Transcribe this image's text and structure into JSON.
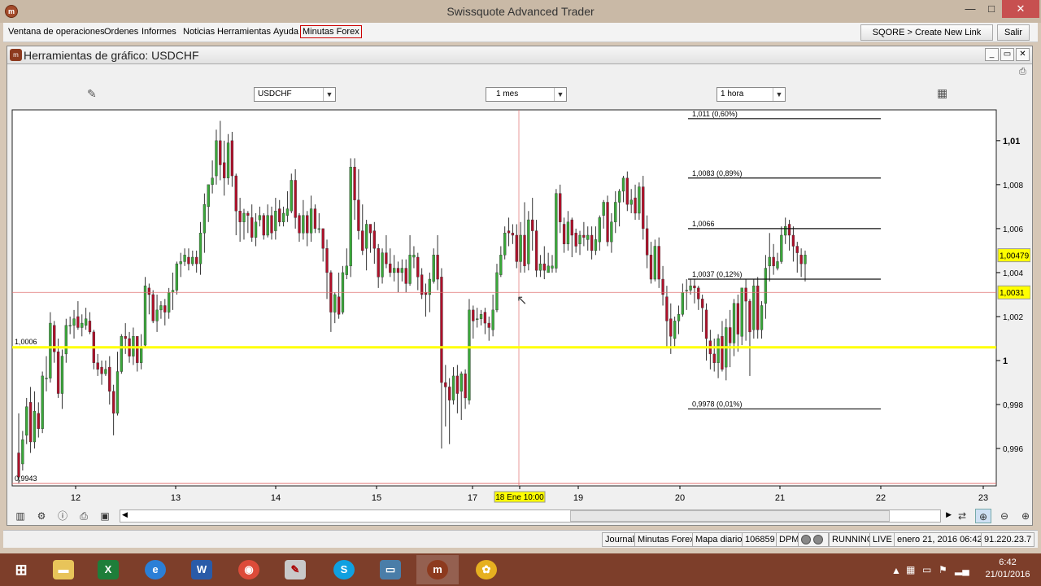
{
  "window": {
    "title": "Swissquote Advanced Trader",
    "min": "—",
    "max": "□",
    "close": "✕"
  },
  "menu": {
    "items": [
      "Ventana de operaciones",
      "Ordenes",
      "Informes",
      "Noticias",
      "Herramientas",
      "Ayuda",
      "Minutas Forex"
    ],
    "create_link": "SQORE > Create New Link",
    "exit": "Salir"
  },
  "chart_window": {
    "title": "Herramientas de gráfico: USDCHF",
    "symbol": "USDCHF",
    "period": "1 mes",
    "interval": "1 hora"
  },
  "status": {
    "items": [
      "Journal",
      "Minutas Forex",
      "Mapa diario",
      "106859",
      "DPM",
      "RUNNING",
      "LIVE",
      "enero 21, 2016 06:42",
      "91.220.23.7"
    ]
  },
  "taskbar": {
    "time": "6:42",
    "date": "21/01/2016"
  },
  "colors": {
    "up": "#3aa83a",
    "down": "#b0102a",
    "hline": "#ffff00",
    "crosshair": "#e07070"
  },
  "chart_data": {
    "type": "candlestick",
    "symbol": "USDCHF",
    "ylim": [
      0.9943,
      1.0114
    ],
    "y_ticks": [
      "1,01",
      "1,008",
      "1,006",
      "1,004",
      "1,002",
      "1",
      "0,998",
      "0,996"
    ],
    "x_ticks": [
      "12",
      "13",
      "14",
      "15",
      "17",
      "18 Ene 10:00",
      "19",
      "20",
      "21",
      "22",
      "23"
    ],
    "x_highlight": "18 Ene 10:00",
    "price_labels": {
      "last": "1,00479",
      "crosshair": "1,0031"
    },
    "left_labels": {
      "hline": "1,0006",
      "low": "0,9943"
    },
    "fib_levels": [
      {
        "price": 1.011,
        "label": "1,011 (0,60%)"
      },
      {
        "price": 1.0083,
        "label": "1,0083 (0,89%)"
      },
      {
        "price": 1.006,
        "label": "1,0066"
      },
      {
        "price": 1.0037,
        "label": "1,0037 (0,12%)"
      },
      {
        "price": 0.9978,
        "label": "0,9978 (0,01%)"
      }
    ],
    "horizontal_line": 1.0006,
    "candles": [
      [
        0.9958,
        0.9947,
        0.9976,
        0.9944
      ],
      [
        0.9953,
        0.9964,
        0.9968,
        0.995
      ],
      [
        0.9966,
        0.9979,
        0.9983,
        0.9962
      ],
      [
        0.9981,
        0.9963,
        0.9988,
        0.9958
      ],
      [
        0.9963,
        0.9977,
        0.9986,
        0.996
      ],
      [
        0.9976,
        0.9969,
        0.9981,
        0.9965
      ],
      [
        0.9969,
        0.9993,
        0.9995,
        0.9967
      ],
      [
        0.9992,
        0.9992,
        1.0002,
        0.9986
      ],
      [
        0.9992,
        1.0017,
        1.0022,
        0.999
      ],
      [
        1.0016,
        1.0004,
        1.0018,
        0.9999
      ],
      [
        1.0004,
        0.9985,
        1.001,
        0.9983
      ],
      [
        0.9985,
        1.0002,
        1.0005,
        0.9978
      ],
      [
        1.0003,
        1.0016,
        1.0019,
        0.9999
      ],
      [
        1.0016,
        1.0016,
        1.002,
        1.0012
      ],
      [
        1.0016,
        1.0019,
        1.0023,
        1.001
      ],
      [
        1.002,
        1.0015,
        1.0027,
        1.0014
      ],
      [
        1.0015,
        1.0017,
        1.0021,
        1.0011
      ],
      [
        1.0016,
        1.0019,
        1.0024,
        1.0014
      ],
      [
        1.0018,
        1.0013,
        1.0022,
        1.0012
      ],
      [
        1.0013,
        0.9999,
        1.0014,
        0.9996
      ],
      [
        0.9999,
        0.9996,
        1.0003,
        0.9993
      ],
      [
        0.9997,
        0.9994,
        1.0,
        0.9989
      ],
      [
        0.9994,
        0.9996,
        1.0,
        0.9993
      ],
      [
        0.9997,
        0.9986,
        1.0002,
        0.998
      ],
      [
        0.9986,
        0.9976,
        0.9989,
        0.9966
      ],
      [
        0.9976,
        0.9995,
        1.0004,
        0.9975
      ],
      [
        0.9995,
        1.0011,
        1.0012,
        0.9994
      ],
      [
        1.0011,
        1.001,
        1.0017,
        1.0003
      ],
      [
        1.001,
        1.0002,
        1.0013,
        0.9999
      ],
      [
        1.0002,
        1.0011,
        1.0015,
        0.9998
      ],
      [
        1.0011,
        0.9999,
        1.0011,
        0.9995
      ],
      [
        0.9999,
        1.0006,
        1.0012,
        0.9996
      ],
      [
        1.0007,
        1.0034,
        1.0038,
        1.0006
      ],
      [
        1.0033,
        1.003,
        1.0035,
        1.0021
      ],
      [
        1.003,
        1.0018,
        1.0032,
        1.0017
      ],
      [
        1.0018,
        1.0023,
        1.003,
        1.0013
      ],
      [
        1.0023,
        1.0025,
        1.0027,
        1.0019
      ],
      [
        1.0025,
        1.0022,
        1.0028,
        1.0016
      ],
      [
        1.0022,
        1.0031,
        1.0033,
        1.0019
      ],
      [
        1.0031,
        1.0032,
        1.004,
        1.0023
      ],
      [
        1.0032,
        1.0044,
        1.0045,
        1.003
      ],
      [
        1.0044,
        1.0045,
        1.0049,
        1.0038
      ],
      [
        1.0045,
        1.0048,
        1.0051,
        1.0043
      ],
      [
        1.0047,
        1.0044,
        1.0051,
        1.0041
      ],
      [
        1.0044,
        1.0047,
        1.005,
        1.0043
      ],
      [
        1.0047,
        1.0044,
        1.005,
        1.004
      ],
      [
        1.0044,
        1.0058,
        1.0063,
        1.0039
      ],
      [
        1.0058,
        1.0071,
        1.0076,
        1.0049
      ],
      [
        1.007,
        1.008,
        1.008,
        1.0063
      ],
      [
        1.008,
        1.0083,
        1.0091,
        1.0076
      ],
      [
        1.0084,
        1.01,
        1.0105,
        1.008
      ],
      [
        1.01,
        1.0089,
        1.0109,
        1.0082
      ],
      [
        1.009,
        1.0083,
        1.01,
        1.0075
      ],
      [
        1.0083,
        1.0099,
        1.0103,
        1.008
      ],
      [
        1.01,
        1.0084,
        1.0104,
        1.0079
      ],
      [
        1.0084,
        1.0068,
        1.0085,
        1.0057
      ],
      [
        1.0068,
        1.0063,
        1.0074,
        1.0054
      ],
      [
        1.0063,
        1.0067,
        1.0069,
        1.0055
      ],
      [
        1.0067,
        1.0066,
        1.0068,
        1.0058
      ],
      [
        1.0065,
        1.0056,
        1.0071,
        1.0054
      ],
      [
        1.0056,
        1.0063,
        1.0067,
        1.0052
      ],
      [
        1.0064,
        1.0066,
        1.007,
        1.0061
      ],
      [
        1.0066,
        1.0057,
        1.0067,
        1.0055
      ],
      [
        1.0057,
        1.0066,
        1.0071,
        1.0056
      ],
      [
        1.0066,
        1.0058,
        1.007,
        1.0055
      ],
      [
        1.0059,
        1.0068,
        1.0074,
        1.0055
      ],
      [
        1.0069,
        1.0063,
        1.0073,
        1.0061
      ],
      [
        1.0063,
        1.0067,
        1.007,
        1.0061
      ],
      [
        1.0066,
        1.0069,
        1.0077,
        1.0063
      ],
      [
        1.0068,
        1.0082,
        1.0085,
        1.0067
      ],
      [
        1.0082,
        1.0065,
        1.0087,
        1.006
      ],
      [
        1.0066,
        1.0058,
        1.0067,
        1.0054
      ],
      [
        1.0058,
        1.0066,
        1.0073,
        1.0055
      ],
      [
        1.0066,
        1.0058,
        1.0068,
        1.0052
      ],
      [
        1.0058,
        1.0069,
        1.0075,
        1.0054
      ],
      [
        1.0069,
        1.006,
        1.0071,
        1.0058
      ],
      [
        1.006,
        1.006,
        1.0067,
        1.0058
      ],
      [
        1.006,
        1.0051,
        1.006,
        1.0045
      ],
      [
        1.0051,
        1.004,
        1.0055,
        1.0028
      ],
      [
        1.004,
        1.0022,
        1.0041,
        1.0013
      ],
      [
        1.0022,
        1.003,
        1.0031,
        1.0017
      ],
      [
        1.0029,
        1.0021,
        1.004,
        1.0019
      ],
      [
        1.0022,
        1.004,
        1.0043,
        1.0021
      ],
      [
        1.0039,
        1.0043,
        1.0051,
        1.0037
      ],
      [
        1.0043,
        1.0088,
        1.0092,
        1.0038
      ],
      [
        1.0088,
        1.0073,
        1.0092,
        1.0064
      ],
      [
        1.0073,
        1.0059,
        1.0087,
        1.0055
      ],
      [
        1.0059,
        1.005,
        1.0071,
        1.0048
      ],
      [
        1.0051,
        1.0062,
        1.0064,
        1.0041
      ],
      [
        1.0062,
        1.0058,
        1.0062,
        1.0049
      ],
      [
        1.0059,
        1.0051,
        1.0063,
        1.0044
      ],
      [
        1.0051,
        1.0038,
        1.0053,
        1.0033
      ],
      [
        1.0038,
        1.0049,
        1.0051,
        1.0035
      ],
      [
        1.0049,
        1.0044,
        1.0057,
        1.0042
      ],
      [
        1.0044,
        1.004,
        1.0051,
        1.0038
      ],
      [
        1.004,
        1.0042,
        1.0048,
        1.0036
      ],
      [
        1.0042,
        1.004,
        1.0045,
        1.0031
      ],
      [
        1.004,
        1.0042,
        1.0046,
        1.0036
      ],
      [
        1.0042,
        1.0035,
        1.0046,
        1.0031
      ],
      [
        1.0035,
        1.0048,
        1.0057,
        1.0034
      ],
      [
        1.0047,
        1.0048,
        1.0052,
        1.0042
      ],
      [
        1.0047,
        1.0038,
        1.0049,
        1.0032
      ],
      [
        1.0039,
        1.003,
        1.0042,
        1.0028
      ],
      [
        1.0031,
        1.003,
        1.0035,
        1.002
      ],
      [
        1.003,
        1.0037,
        1.004,
        1.0022
      ],
      [
        1.0036,
        1.0048,
        1.0051,
        1.0035
      ],
      [
        1.0048,
        1.0037,
        1.0057,
        1.0032
      ],
      [
        1.0038,
        0.999,
        1.0042,
        0.996
      ],
      [
        0.999,
        0.9988,
        0.9998,
        0.997
      ],
      [
        0.9988,
        0.9982,
        0.9992,
        0.9962
      ],
      [
        0.9982,
        0.9993,
        0.9997,
        0.998
      ],
      [
        0.9993,
        0.9985,
        0.9998,
        0.9976
      ],
      [
        0.9986,
        0.9994,
        0.9995,
        0.9973
      ],
      [
        0.9994,
        0.9983,
        0.9996,
        0.9978
      ],
      [
        0.9982,
        1.0023,
        1.0028,
        0.998
      ],
      [
        1.0023,
        1.0018,
        1.0025,
        1.001
      ],
      [
        1.0019,
        1.0019,
        1.0024,
        1.0015
      ],
      [
        1.0019,
        1.0021,
        1.0023,
        1.0016
      ],
      [
        1.0022,
        1.0017,
        1.0024,
        1.0012
      ],
      [
        1.0017,
        1.0015,
        1.002,
        1.0009
      ],
      [
        1.0014,
        1.0023,
        1.003,
        1.0011
      ],
      [
        1.0023,
        1.004,
        1.0044,
        1.0022
      ],
      [
        1.0039,
        1.0048,
        1.0052,
        1.0038
      ],
      [
        1.0048,
        1.0058,
        1.0061,
        1.0046
      ],
      [
        1.0059,
        1.0058,
        1.0065,
        1.0052
      ],
      [
        1.0058,
        1.0057,
        1.0062,
        1.0053
      ],
      [
        1.0057,
        1.0045,
        1.0062,
        1.0042
      ],
      [
        1.0045,
        1.0057,
        1.0063,
        1.004
      ],
      [
        1.0057,
        1.0043,
        1.0072,
        1.004
      ],
      [
        1.0044,
        1.0064,
        1.0068,
        1.0041
      ],
      [
        1.0064,
        1.0059,
        1.0074,
        1.005
      ],
      [
        1.0059,
        1.0041,
        1.0064,
        1.0038
      ],
      [
        1.0041,
        1.0044,
        1.0048,
        1.0038
      ],
      [
        1.0044,
        1.0041,
        1.0052,
        1.0037
      ],
      [
        1.004,
        1.0043,
        1.0049,
        1.004
      ],
      [
        1.0042,
        1.0043,
        1.0048,
        1.004
      ],
      [
        1.0042,
        1.0076,
        1.0078,
        1.004
      ],
      [
        1.0076,
        1.0063,
        1.008,
        1.0058
      ],
      [
        1.0062,
        1.0053,
        1.0065,
        1.0049
      ],
      [
        1.0053,
        1.0063,
        1.0068,
        1.005
      ],
      [
        1.0064,
        1.0057,
        1.0065,
        1.0047
      ],
      [
        1.0058,
        1.0052,
        1.006,
        1.0049
      ],
      [
        1.0053,
        1.0057,
        1.0059,
        1.0048
      ],
      [
        1.0057,
        1.0056,
        1.0063,
        1.0052
      ],
      [
        1.0055,
        1.0057,
        1.0061,
        1.005
      ],
      [
        1.0057,
        1.005,
        1.0061,
        1.0046
      ],
      [
        1.005,
        1.0055,
        1.0061,
        1.0048
      ],
      [
        1.0054,
        1.0065,
        1.0066,
        1.005
      ],
      [
        1.0066,
        1.0072,
        1.0073,
        1.006
      ],
      [
        1.0072,
        1.0054,
        1.0075,
        1.0052
      ],
      [
        1.0054,
        1.0063,
        1.0067,
        1.0049
      ],
      [
        1.0063,
        1.0072,
        1.0077,
        1.0058
      ],
      [
        1.0072,
        1.0077,
        1.0078,
        1.0061
      ],
      [
        1.0077,
        1.0083,
        1.0084,
        1.0072
      ],
      [
        1.0083,
        1.0071,
        1.0086,
        1.0068
      ],
      [
        1.0071,
        1.0073,
        1.0078,
        1.0067
      ],
      [
        1.0074,
        1.0067,
        1.008,
        1.0064
      ],
      [
        1.0067,
        1.0079,
        1.0081,
        1.0064
      ],
      [
        1.0079,
        1.006,
        1.0084,
        1.0055
      ],
      [
        1.006,
        1.0048,
        1.0066,
        1.0042
      ],
      [
        1.0048,
        1.0037,
        1.0054,
        1.0035
      ],
      [
        1.0037,
        1.0052,
        1.0055,
        1.0036
      ],
      [
        1.0052,
        1.0037,
        1.0056,
        1.0033
      ],
      [
        1.0037,
        1.003,
        1.0043,
        1.0025
      ],
      [
        1.0029,
        1.0018,
        1.0034,
        1.0006
      ],
      [
        1.0019,
        1.0011,
        1.0026,
        1.0003
      ],
      [
        1.001,
        1.0018,
        1.002,
        1.0006
      ],
      [
        1.0018,
        1.0021,
        1.0025,
        1.0012
      ],
      [
        1.0021,
        1.0031,
        1.0035,
        1.002
      ],
      [
        1.0032,
        1.0032,
        1.0037,
        1.0023
      ],
      [
        1.0032,
        1.0034,
        1.0037,
        1.003
      ],
      [
        1.0034,
        1.0033,
        1.0037,
        1.0026
      ],
      [
        1.0033,
        1.0028,
        1.0034,
        1.0023
      ],
      [
        1.0028,
        1.0024,
        1.003,
        1.0013
      ],
      [
        1.0023,
        1.001,
        1.0026,
        1.0
      ],
      [
        1.0009,
        1.0003,
        1.0014,
        0.9996
      ],
      [
        1.0003,
        0.9999,
        1.001,
        0.9995
      ],
      [
        0.9999,
        1.001,
        1.0012,
        0.9992
      ],
      [
        1.0011,
        0.9996,
        1.0018,
        0.9995
      ],
      [
        0.9997,
        1.0015,
        1.0019,
        0.9991
      ],
      [
        1.0015,
        1.0008,
        1.0023,
        0.9997
      ],
      [
        1.0008,
        1.0026,
        1.0028,
        1.0002
      ],
      [
        1.0026,
        1.0012,
        1.003,
        1.0004
      ],
      [
        1.0011,
        1.0033,
        1.0033,
        1.0007
      ],
      [
        1.0033,
        1.0027,
        1.0037,
        1.0009
      ],
      [
        1.0027,
        1.0013,
        1.0028,
        0.9993
      ],
      [
        1.0014,
        1.0034,
        1.0037,
        1.001
      ],
      [
        1.0034,
        1.0014,
        1.0038,
        1.001
      ],
      [
        1.0014,
        1.0025,
        1.0027,
        1.001
      ],
      [
        1.0026,
        1.0042,
        1.0048,
        1.0019
      ],
      [
        1.0043,
        1.0047,
        1.0058,
        1.0036
      ],
      [
        1.0047,
        1.0043,
        1.0053,
        1.0039
      ],
      [
        1.0042,
        1.0045,
        1.0049,
        1.0041
      ],
      [
        1.0045,
        1.0057,
        1.0061,
        1.0044
      ],
      [
        1.0057,
        1.0061,
        1.0065,
        1.0053
      ],
      [
        1.0062,
        1.0057,
        1.0064,
        1.005
      ],
      [
        1.0057,
        1.0052,
        1.0061,
        1.0045
      ],
      [
        1.0052,
        1.0049,
        1.0054,
        1.004
      ],
      [
        1.0048,
        1.0044,
        1.0051,
        1.0038
      ],
      [
        1.0044,
        1.0048,
        1.005,
        1.0036
      ]
    ]
  }
}
